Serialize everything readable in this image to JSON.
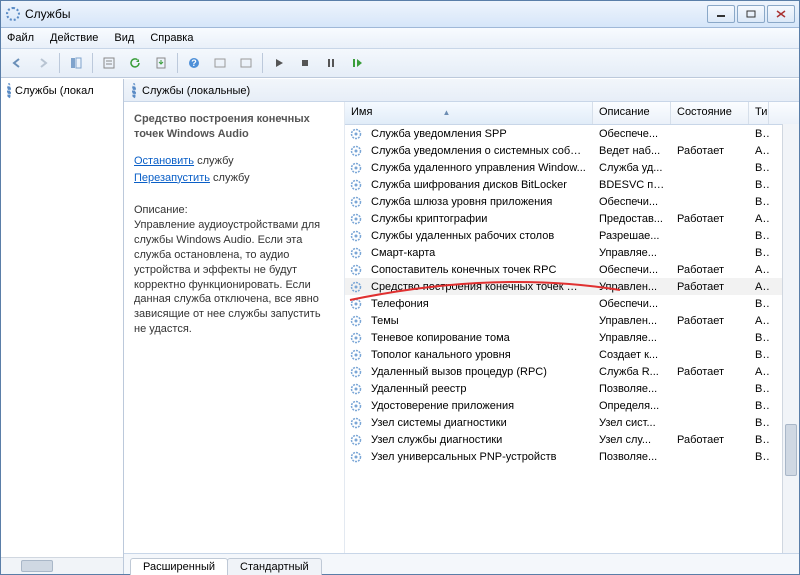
{
  "window": {
    "title": "Службы"
  },
  "menu": {
    "file": "Файл",
    "action": "Действие",
    "view": "Вид",
    "help": "Справка"
  },
  "nav": {
    "label": "Службы (локал"
  },
  "paneHeader": "Службы (локальные)",
  "detail": {
    "title": "Средство построения конечных точек Windows Audio",
    "stopPrefix": "Остановить",
    "stopSuffix": " службу",
    "restartPrefix": "Перезапустить",
    "restartSuffix": " службу",
    "descLabel": "Описание:",
    "desc": "Управление аудиоустройствами для службы Windows Audio. Если эта служба остановлена, то аудио устройства и эффекты не будут корректно функционировать. Если данная служба отключена, все явно зависящие от нее службы запустить не удастся."
  },
  "columns": {
    "name": "Имя",
    "desc": "Описание",
    "state": "Состояние",
    "type": "Ти"
  },
  "tabs": {
    "extended": "Расширенный",
    "standard": "Стандартный"
  },
  "rows": [
    {
      "n": "Служба уведомления SPP",
      "d": "Обеспече...",
      "s": "",
      "t": "Вр"
    },
    {
      "n": "Служба уведомления о системных собы...",
      "d": "Ведет наб...",
      "s": "Работает",
      "t": "Ав"
    },
    {
      "n": "Служба удаленного управления Window...",
      "d": "Служба уд...",
      "s": "",
      "t": "Вр"
    },
    {
      "n": "Служба шифрования дисков BitLocker",
      "d": "BDESVC пр...",
      "s": "",
      "t": "Вр"
    },
    {
      "n": "Служба шлюза уровня приложения",
      "d": "Обеспечи...",
      "s": "",
      "t": "Вр"
    },
    {
      "n": "Службы криптографии",
      "d": "Предостав...",
      "s": "Работает",
      "t": "Ав"
    },
    {
      "n": "Службы удаленных рабочих столов",
      "d": "Разрешае...",
      "s": "",
      "t": "Вр"
    },
    {
      "n": "Смарт-карта",
      "d": "Управляе...",
      "s": "",
      "t": "Вр"
    },
    {
      "n": "Сопоставитель конечных точек RPC",
      "d": "Обеспечи...",
      "s": "Работает",
      "t": "Ав"
    },
    {
      "n": "Средство построения конечных точек Wi...",
      "d": "Управлен...",
      "s": "Работает",
      "t": "Ав",
      "sel": true
    },
    {
      "n": "Телефония",
      "d": "Обеспечи...",
      "s": "",
      "t": "Вр"
    },
    {
      "n": "Темы",
      "d": "Управлен...",
      "s": "Работает",
      "t": "Ав"
    },
    {
      "n": "Теневое копирование тома",
      "d": "Управляе...",
      "s": "",
      "t": "Вр"
    },
    {
      "n": "Тополог канального уровня",
      "d": "Создает к...",
      "s": "",
      "t": "Вр"
    },
    {
      "n": "Удаленный вызов процедур (RPC)",
      "d": "Служба R...",
      "s": "Работает",
      "t": "Ав"
    },
    {
      "n": "Удаленный реестр",
      "d": "Позволяе...",
      "s": "",
      "t": "Вр"
    },
    {
      "n": "Удостоверение приложения",
      "d": "Определя...",
      "s": "",
      "t": "Вр"
    },
    {
      "n": "Узел системы диагностики",
      "d": "Узел сист...",
      "s": "",
      "t": "Вр"
    },
    {
      "n": "Узел службы диагностики",
      "d": "Узел слу...",
      "s": "Работает",
      "t": "Вр"
    },
    {
      "n": "Узел универсальных PNP-устройств",
      "d": "Позволяе...",
      "s": "",
      "t": "Вр"
    }
  ]
}
